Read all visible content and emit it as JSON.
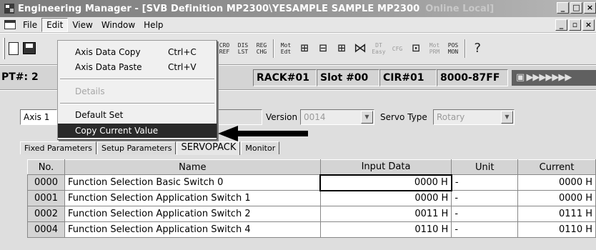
{
  "window": {
    "title": "Engineering Manager - [SVB Definition   MP2300\\YESAMPLE SAMPLE MP2300",
    "status": "Online  Local]"
  },
  "menubar": {
    "items": [
      "File",
      "Edit",
      "View",
      "Window",
      "Help"
    ]
  },
  "edit_menu": {
    "items": [
      {
        "label": "Axis Data Copy",
        "shortcut": "Ctrl+C"
      },
      {
        "label": "Axis Data Paste",
        "shortcut": "Ctrl+V"
      },
      {
        "label": "Details",
        "shortcut": ""
      },
      {
        "label": "Default Set",
        "shortcut": ""
      },
      {
        "label": "Copy Current Value",
        "shortcut": ""
      }
    ]
  },
  "toolbar": {
    "icons": [
      {
        "top": "CRO",
        "bottom": "REF"
      },
      {
        "top": "DIS",
        "bottom": "LST"
      },
      {
        "top": "REG",
        "bottom": "CHG"
      },
      {
        "top": "Mot",
        "bottom": "Edt"
      },
      {
        "top": "DT",
        "bottom": "Easy"
      },
      {
        "top": "CFG",
        "bottom": ""
      },
      {
        "top": "Mot",
        "bottom": "PRM"
      },
      {
        "top": "POS",
        "bottom": "MON"
      }
    ]
  },
  "status": {
    "pt": "PT#: 2",
    "rack": "RACK#01",
    "slot": "Slot #00",
    "cir": "CIR#01",
    "address": "8000-87FF",
    "indicator": "▶▶▶▶▶▶▶"
  },
  "form": {
    "axis": "Axis 1",
    "version_label": "Version",
    "version_value": "0014",
    "servo_type_label": "Servo Type",
    "servo_type_value": "Rotary"
  },
  "tabs": [
    "Fixed Parameters",
    "Setup Parameters",
    "SERVOPACK",
    "Monitor"
  ],
  "table": {
    "headers": [
      "No.",
      "Name",
      "Input Data",
      "Unit",
      "Current"
    ],
    "rows": [
      {
        "no": "0000",
        "name": "Function Selection Basic Switch 0",
        "input": "0000 H",
        "unit": "-",
        "current": "0000 H"
      },
      {
        "no": "0001",
        "name": "Function Selection Application Switch 1",
        "input": "0000 H",
        "unit": "-",
        "current": "0000 H"
      },
      {
        "no": "0002",
        "name": "Function Selection Application Switch 2",
        "input": "0011 H",
        "unit": "-",
        "current": "0111 H"
      },
      {
        "no": "0004",
        "name": "Function Selection Application Switch 4",
        "input": "0110 H",
        "unit": "-",
        "current": "0110 H"
      }
    ]
  }
}
